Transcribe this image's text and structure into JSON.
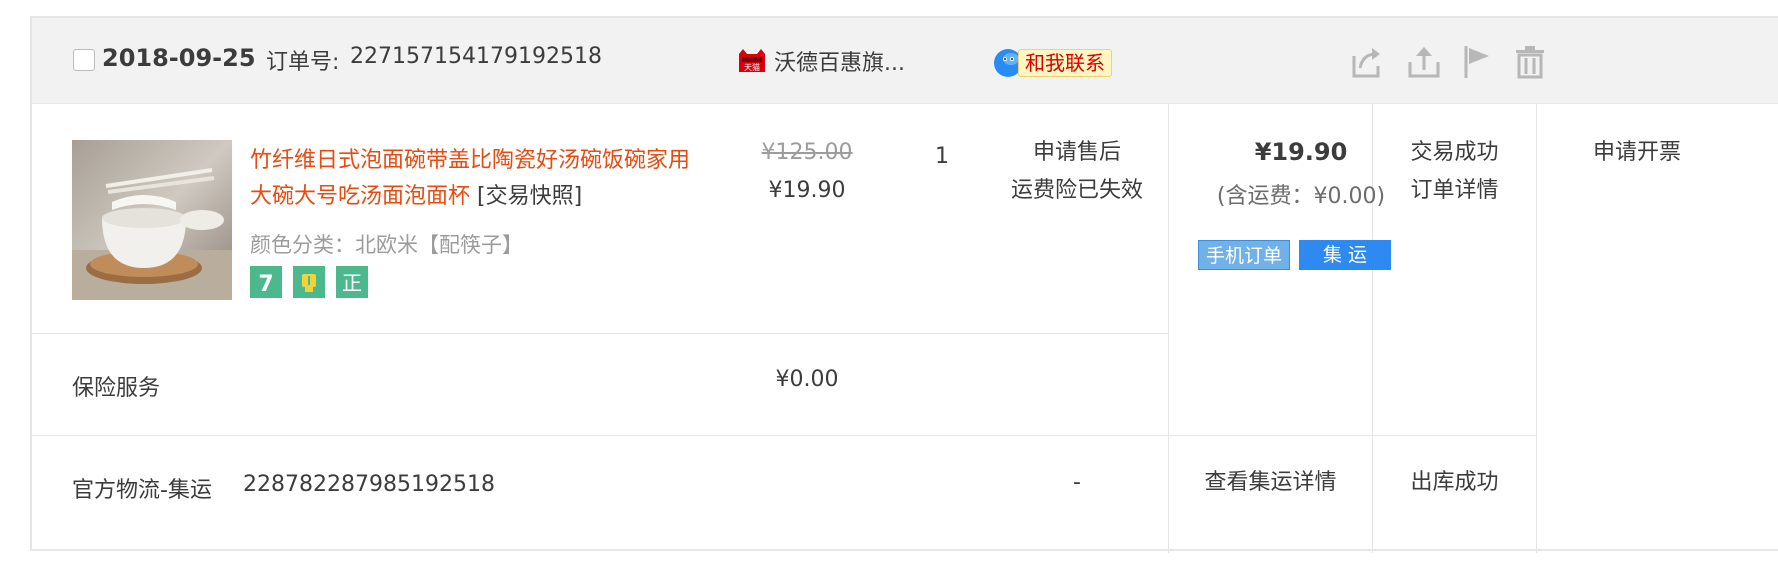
{
  "header": {
    "date": "2018-09-25",
    "order_no_label": "订单号:",
    "order_no": "227157154179192518",
    "shop_name": "沃德百惠旗...",
    "contact_label": "和我联系",
    "tmall_badge": "天猫",
    "icons": [
      "share-icon",
      "upload-icon",
      "flag-icon",
      "trash-icon"
    ]
  },
  "product": {
    "title": "竹纤维日式泡面碗带盖比陶瓷好汤碗饭碗家用大碗大号吃汤面泡面杯",
    "snapshot_link": "[交易快照]",
    "sku": "颜色分类：北欧米【配筷子】",
    "badges": [
      {
        "name": "seven-day-return-icon",
        "glyph": "7",
        "color": "#4cb88e"
      },
      {
        "name": "shipping-guarantee-icon",
        "glyph": "",
        "color": "#4cb88e"
      },
      {
        "name": "authentic-icon",
        "glyph": "正",
        "color": "#4cb88e"
      }
    ],
    "original_price": "¥125.00",
    "price": "¥19.90",
    "quantity": "1",
    "aftersale": "申请售后",
    "freight_insurance": "运费险已失效"
  },
  "payment": {
    "total": "¥19.90",
    "shipping_note": "(含运费：¥0.00)",
    "tags": [
      "手机订单",
      "集 运"
    ]
  },
  "status": {
    "state": "交易成功",
    "detail_link": "订单详情"
  },
  "invoice": {
    "label": "申请开票"
  },
  "insurance": {
    "label": "保险服务",
    "price": "¥0.00"
  },
  "logistics": {
    "label": "官方物流-集运",
    "tracking_no": "228782287985192518",
    "dash": "-",
    "detail_link": "查看集运详情",
    "status": "出库成功"
  },
  "colors": {
    "accent_title": "#e94a10",
    "header_bg": "#f2f2f2",
    "tag_blue": "#2e89f0",
    "border": "#e6e6e6"
  }
}
